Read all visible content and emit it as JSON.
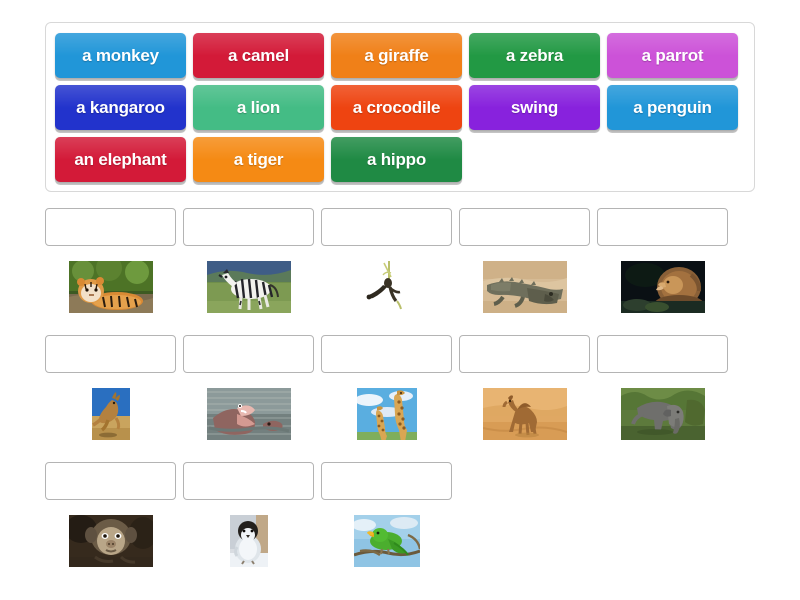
{
  "activity": {
    "type": "match-up-drag-and-drop",
    "title": "Match up"
  },
  "tile_bank": {
    "rows": [
      [
        {
          "label": "a monkey",
          "color": "#2196d8"
        },
        {
          "label": "a camel",
          "color": "#d31a38"
        },
        {
          "label": "a giraffe",
          "color": "#f08018"
        },
        {
          "label": "a zebra",
          "color": "#229944"
        },
        {
          "label": "a parrot",
          "color": "#cc52d8"
        }
      ],
      [
        {
          "label": "a kangaroo",
          "color": "#2233cc"
        },
        {
          "label": "a lion",
          "color": "#44bc85"
        },
        {
          "label": "a crocodile",
          "color": "#ee4411"
        },
        {
          "label": "swing",
          "color": "#8822dd"
        },
        {
          "label": "a penguin",
          "color": "#2196d8"
        }
      ],
      [
        {
          "label": "an elephant",
          "color": "#d31a38"
        },
        {
          "label": "a tiger",
          "color": "#f58a14"
        },
        {
          "label": "a hippo",
          "color": "#1f8a44"
        }
      ]
    ]
  },
  "answers": {
    "rows": [
      [
        {
          "dropzone_value": "",
          "image_name": "tiger-photo",
          "image_alt": "tiger lying on a rock"
        },
        {
          "dropzone_value": "",
          "image_name": "zebra-photo",
          "image_alt": "zebra standing in a grassy field"
        },
        {
          "dropzone_value": "",
          "image_name": "swing-photo",
          "image_alt": "child swinging on a rope swing"
        },
        {
          "dropzone_value": "",
          "image_name": "crocodile-photo",
          "image_alt": "crocodile on sand"
        },
        {
          "dropzone_value": "",
          "image_name": "lion-photo",
          "image_alt": "lion roaring on a dark background"
        }
      ],
      [
        {
          "dropzone_value": "",
          "image_name": "kangaroo-photo",
          "image_alt": "kangaroo hopping across dry grass"
        },
        {
          "dropzone_value": "",
          "image_name": "hippo-photo",
          "image_alt": "hippo with open mouth in water"
        },
        {
          "dropzone_value": "",
          "image_name": "giraffe-photo",
          "image_alt": "two giraffes under a blue sky"
        },
        {
          "dropzone_value": "",
          "image_name": "camel-photo",
          "image_alt": "camel walking in the desert"
        },
        {
          "dropzone_value": "",
          "image_name": "elephant-photo",
          "image_alt": "elephant beside green bushes"
        }
      ],
      [
        {
          "dropzone_value": "",
          "image_name": "monkey-photo",
          "image_alt": "monkey face close up"
        },
        {
          "dropzone_value": "",
          "image_name": "penguin-photo",
          "image_alt": "baby penguin chick on snow"
        },
        {
          "dropzone_value": "",
          "image_name": "parrot-photo",
          "image_alt": "green parrot perched on a branch"
        }
      ]
    ]
  }
}
